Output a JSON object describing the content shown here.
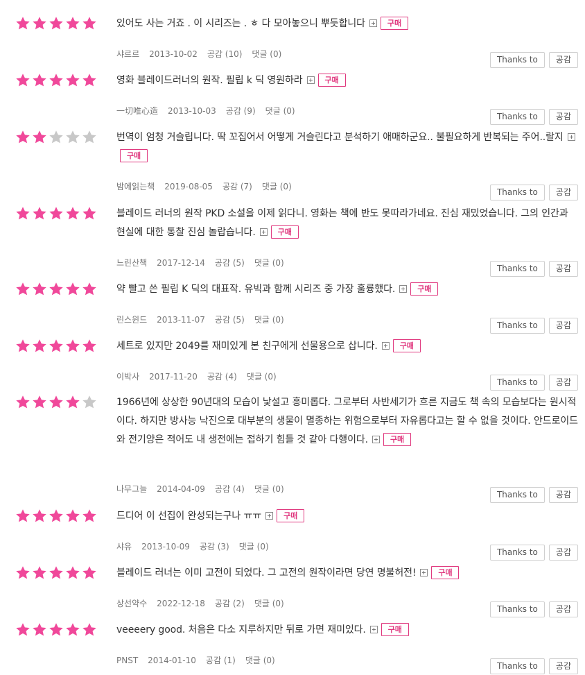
{
  "colors": {
    "star_on": "#f0489a",
    "star_off": "#c8c8c8",
    "buy": "#e0397f"
  },
  "labels": {
    "thanks": "Thanks to",
    "like": "공감",
    "buy": "구매",
    "expand_icon": "expand-plus-icon"
  },
  "reviews": [
    {
      "rating": 5,
      "text": "있어도 사는 거죠 . 이 시리즈는 . ㅎ 다 모아놓으니 뿌듯합니다",
      "user": "샤르르",
      "date": "2013-10-02",
      "likes": "공감 (10)",
      "comments": "댓글 (0)"
    },
    {
      "rating": 5,
      "text": "영화 블레이드러너의 원작. 필립 k 딕 영원하라",
      "user": "一切唯心造",
      "date": "2013-10-03",
      "likes": "공감 (9)",
      "comments": "댓글 (0)"
    },
    {
      "rating": 2,
      "text": "번역이 엄청 거슬립니다. 딱 꼬집어서 어떻게 거슬린다고 분석하기 애매하군요.. 불필요하게 반복되는 주어..랄지",
      "user": "밤에읽는책",
      "date": "2019-08-05",
      "likes": "공감 (7)",
      "comments": "댓글 (0)"
    },
    {
      "rating": 5,
      "text": "블레이드 러너의 원작 PKD 소설을 이제 읽다니. 영화는 책에 반도 못따라가네요. 진심 재밌었습니다. 그의 인간과 현실에 대한 통찰 진심 놀랍습니다.",
      "user": "느린산책",
      "date": "2017-12-14",
      "likes": "공감 (5)",
      "comments": "댓글 (0)"
    },
    {
      "rating": 5,
      "text": "약 빨고 쓴 필립 K 딕의 대표작. 유빅과 함께 시리즈 중 가장 훌륭했다.",
      "user": "린스윈드",
      "date": "2013-11-07",
      "likes": "공감 (5)",
      "comments": "댓글 (0)"
    },
    {
      "rating": 5,
      "text": "세트로 있지만 2049를 재미있게 본 친구에게 선물용으로 삽니다.",
      "user": "이박사",
      "date": "2017-11-20",
      "likes": "공감 (4)",
      "comments": "댓글 (0)"
    },
    {
      "rating": 4,
      "text": "1966년에 상상한 90년대의 모습이 낯설고 흥미롭다. 그로부터 사반세기가 흐른 지금도 책 속의 모습보다는 원시적이다. 하지만 방사능 낙진으로 대부분의 생물이 멸종하는 위험으로부터 자유롭다고는 할 수 없을 것이다. 안드로이드와 전기양은 적어도 내 생전에는 접하기 힘들 것 같아 다행이다.",
      "user": "나무그늘",
      "date": "2014-04-09",
      "likes": "공감 (4)",
      "comments": "댓글 (0)"
    },
    {
      "rating": 5,
      "text": "드디어 이 선집이 완성되는구나 ㅠㅠ",
      "user": "샤유",
      "date": "2013-10-09",
      "likes": "공감 (3)",
      "comments": "댓글 (0)"
    },
    {
      "rating": 5,
      "text": "블레이드 러너는 이미 고전이 되었다. 그 고전의 원작이라면 당연 명불허전!",
      "user": "상선약수",
      "date": "2022-12-18",
      "likes": "공감 (2)",
      "comments": "댓글 (0)"
    },
    {
      "rating": 5,
      "text": "veeeery good. 처음은 다소 지루하지만 뒤로 가면 재미있다.",
      "user": "PNST",
      "date": "2014-01-10",
      "likes": "공감 (1)",
      "comments": "댓글 (0)"
    }
  ]
}
